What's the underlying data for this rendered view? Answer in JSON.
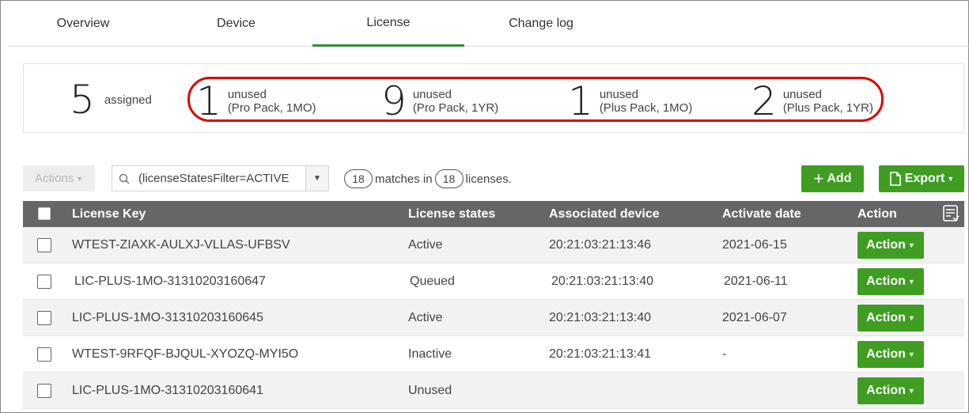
{
  "tabs": [
    {
      "label": "Overview"
    },
    {
      "label": "Device"
    },
    {
      "label": "License",
      "active": true
    },
    {
      "label": "Change log"
    }
  ],
  "summary": {
    "assigned": {
      "count": "5",
      "label": "assigned"
    },
    "unused": [
      {
        "count": "1",
        "line1": "unused",
        "line2": "(Pro Pack, 1MO)"
      },
      {
        "count": "9",
        "line1": "unused",
        "line2": "(Pro Pack, 1YR)"
      },
      {
        "count": "1",
        "line1": "unused",
        "line2": "(Plus Pack, 1MO)"
      },
      {
        "count": "2",
        "line1": "unused",
        "line2": "(Plus Pack, 1YR)"
      }
    ],
    "highlight_color": "#e00000"
  },
  "toolbar": {
    "actions_label": "Actions",
    "search_value": "(licenseStatesFilter=ACTIVE",
    "matches_count": "18",
    "matches_text": "matches in",
    "total_count": "18",
    "total_text": "licenses.",
    "add_label": "Add",
    "export_label": "Export"
  },
  "table": {
    "headers": {
      "key": "License Key",
      "state": "License states",
      "device": "Associated device",
      "date": "Activate date",
      "action": "Action"
    },
    "rows": [
      {
        "key": "WTEST-ZIAXK-AULXJ-VLLAS-UFBSV",
        "state": "Active",
        "device": "20:21:03:21:13:46",
        "date": "2021-06-15",
        "action": "Action"
      },
      {
        "key": "LIC-PLUS-1MO-31310203160647",
        "state": "Queued",
        "device": "20:21:03:21:13:40",
        "date": "2021-06-11",
        "action": "Action"
      },
      {
        "key": "LIC-PLUS-1MO-31310203160645",
        "state": "Active",
        "device": "20:21:03:21:13:40",
        "date": "2021-06-07",
        "action": "Action"
      },
      {
        "key": "WTEST-9RFQF-BJQUL-XYOZQ-MYI5O",
        "state": "Inactive",
        "device": "20:21:03:21:13:41",
        "date": "-",
        "action": "Action"
      },
      {
        "key": "LIC-PLUS-1MO-31310203160641",
        "state": "Unused",
        "device": "",
        "date": "",
        "action": "Action"
      }
    ]
  },
  "colors": {
    "accent_green": "#3f9e22",
    "header_gray": "#666666",
    "tab_underline": "#2f8f3a"
  }
}
